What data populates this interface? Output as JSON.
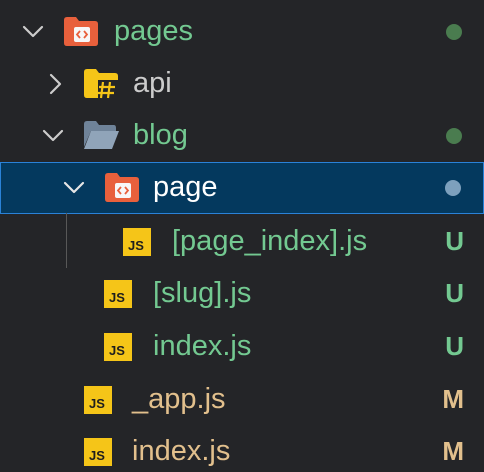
{
  "colors": {
    "green_text": "#73c991",
    "gray_text": "#cccccc",
    "white_text": "#ffffff",
    "modified_text": "#e2c08d",
    "green_dot": "#4a7c4f",
    "selected_dot": "#7da0bd",
    "selected_bg": "#04395e",
    "selected_border": "#2a82d8",
    "js_yellow": "#f5c518",
    "pages_folder": "#e8603c",
    "api_folder": "#f5c518",
    "blog_folder": "#8ca2b8"
  },
  "tree": {
    "pages": {
      "label": "pages",
      "icon": "next-folder-icon",
      "expanded": true
    },
    "api": {
      "label": "api",
      "icon": "api-folder-icon",
      "expanded": false
    },
    "blog": {
      "label": "blog",
      "icon": "folder-open-icon",
      "expanded": true
    },
    "page": {
      "label": "page",
      "icon": "next-folder-icon",
      "expanded": true,
      "selected": true
    },
    "page_index": {
      "label": "[page_index].js",
      "icon": "js-file-icon",
      "status": "U"
    },
    "slug": {
      "label": "[slug].js",
      "icon": "js-file-icon",
      "status": "U"
    },
    "blog_index": {
      "label": "index.js",
      "icon": "js-file-icon",
      "status": "U"
    },
    "app": {
      "label": "_app.js",
      "icon": "js-file-icon",
      "status": "M"
    },
    "pages_index": {
      "label": "index.js",
      "icon": "js-file-icon",
      "status": "M"
    }
  },
  "js_icon_text": "JS"
}
